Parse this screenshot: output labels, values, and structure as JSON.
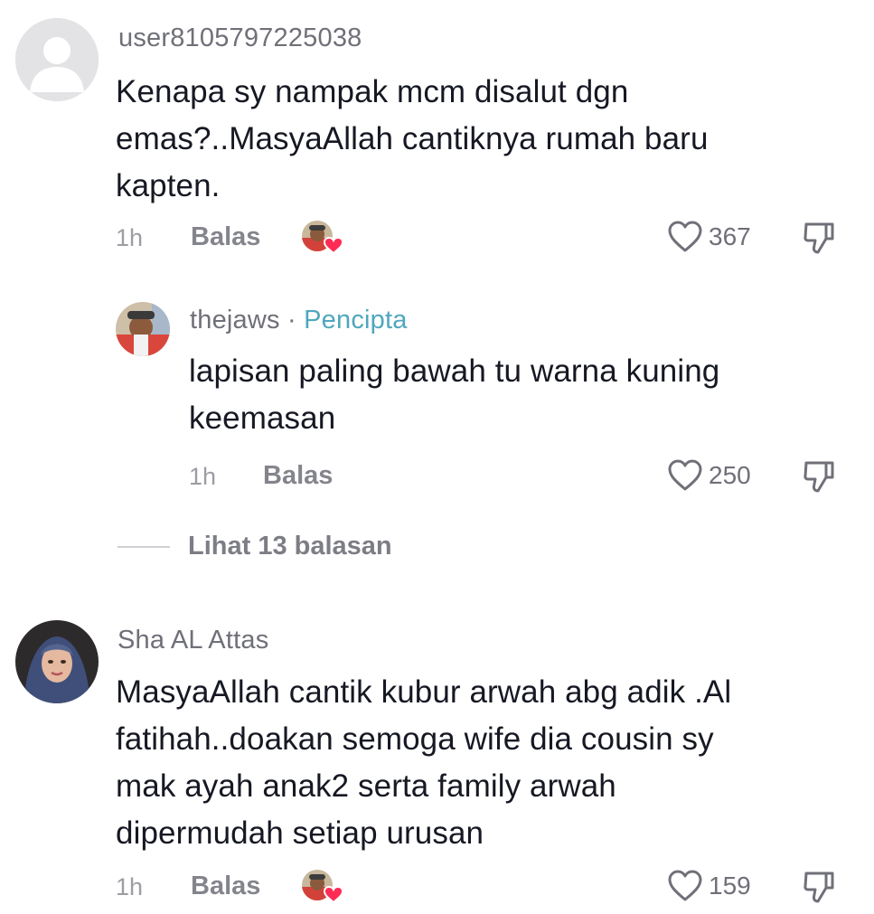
{
  "comments": [
    {
      "username": "user8105797225038",
      "text_lines": [
        "Kenapa sy nampak mcm disalut dgn",
        "emas?..MasyaAllah cantiknya rumah baru",
        "kapten."
      ],
      "time": "1h",
      "reply_label": "Balas",
      "likes": "367",
      "avatar_icon": "default-user-icon"
    },
    {
      "username": "thejaws",
      "creator_separator": "·",
      "creator_badge": "Pencipta",
      "text_lines": [
        "lapisan paling bawah tu warna kuning",
        "keemasan"
      ],
      "time": "1h",
      "reply_label": "Balas",
      "likes": "250"
    },
    {
      "username": "Sha AL Attas",
      "text_lines": [
        "MasyaAllah cantik kubur arwah abg adik .Al",
        "fatihah..doakan semoga wife dia cousin sy",
        "mak ayah anak2 serta family arwah",
        "dipermudah setiap urusan"
      ],
      "time": "1h",
      "reply_label": "Balas",
      "likes": "159"
    }
  ],
  "view_replies": {
    "label": "Lihat 13 balasan"
  },
  "colors": {
    "creator_badge": "#4fa7bd",
    "liked_heart": "#fe2c55",
    "muted_text": "#6f7078"
  }
}
